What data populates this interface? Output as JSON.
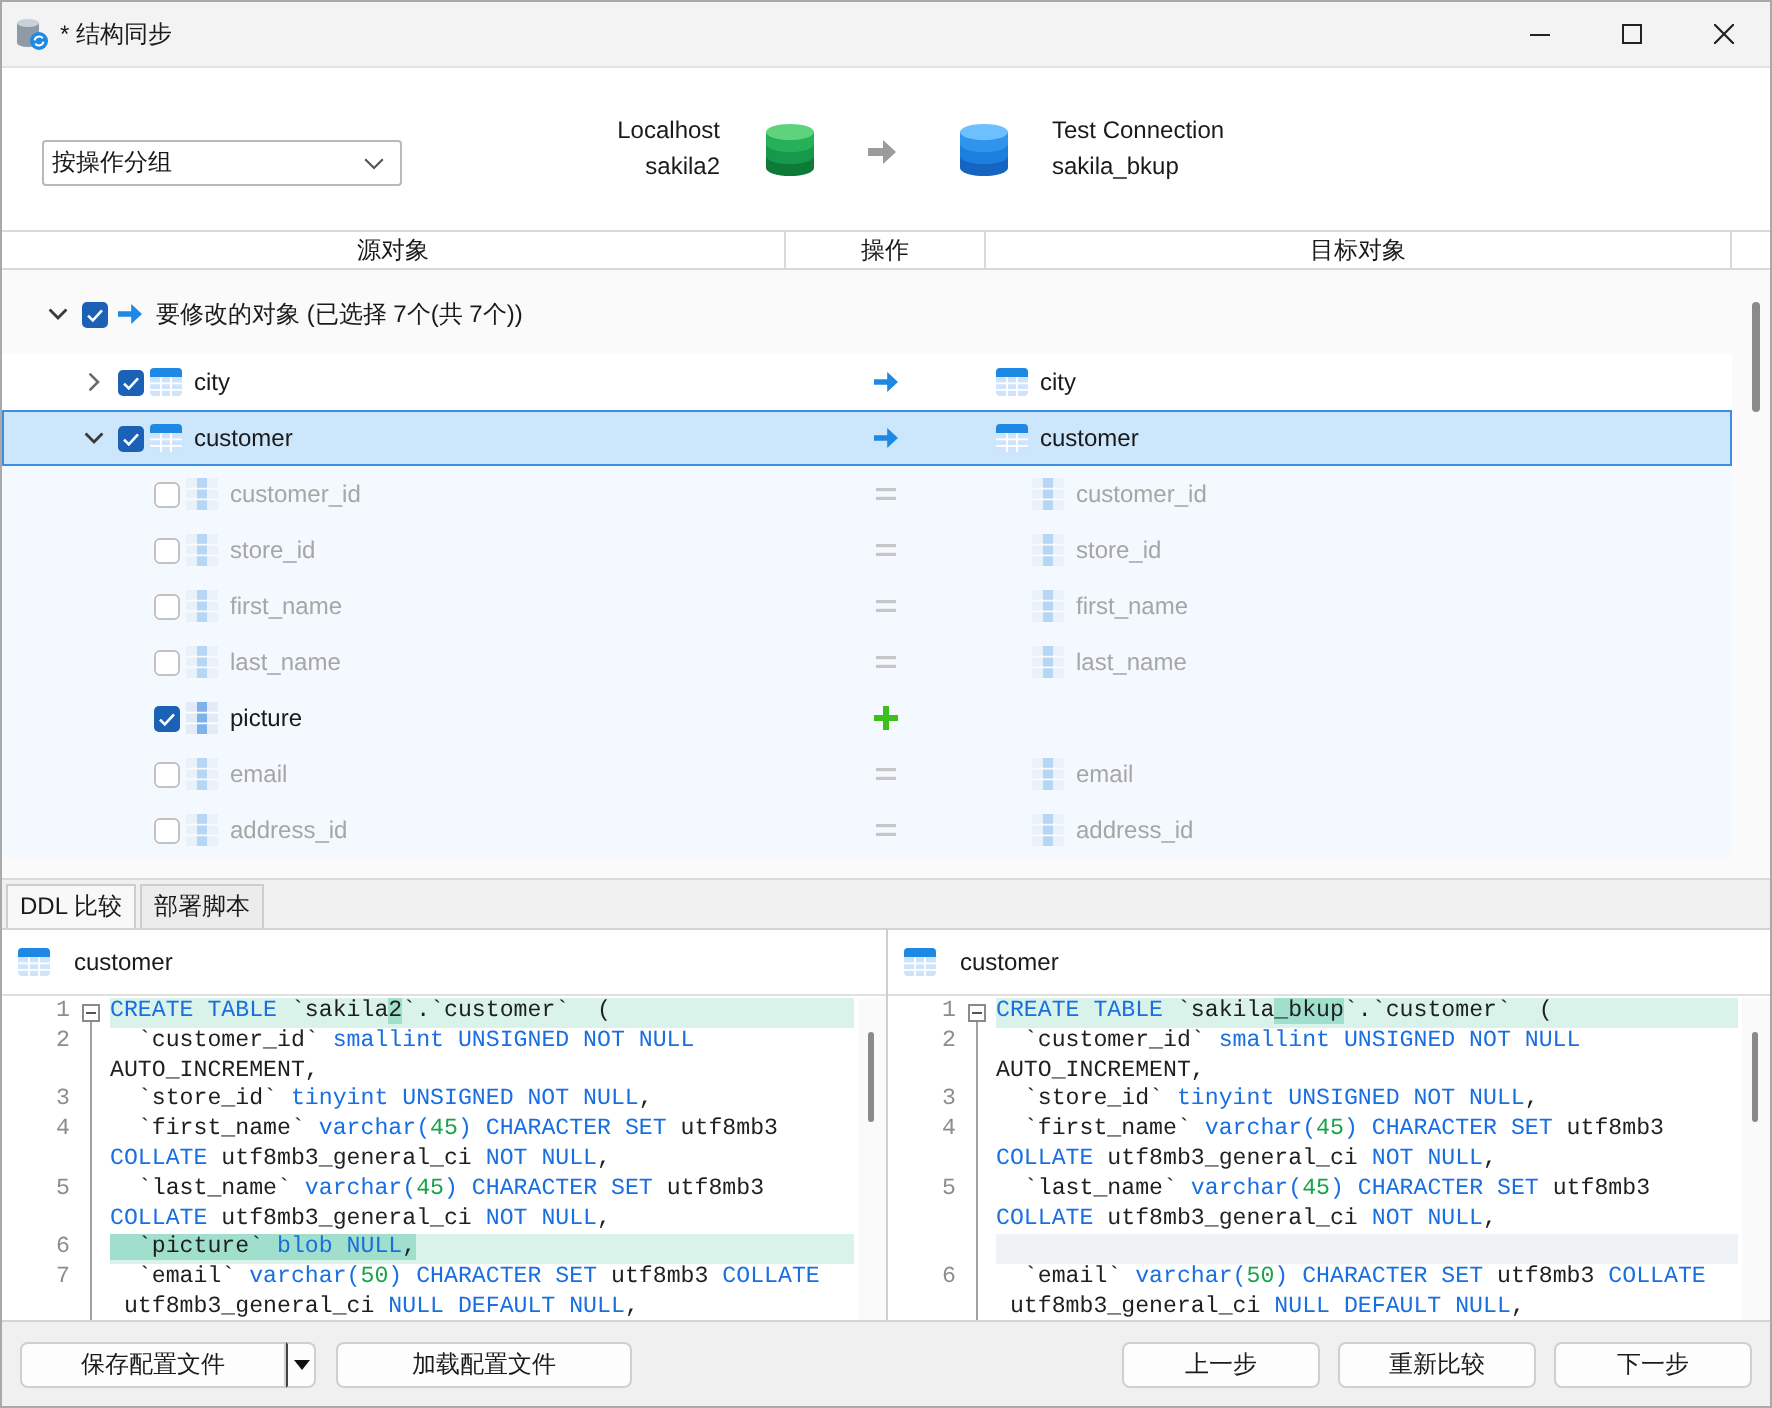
{
  "window": {
    "title": "* 结构同步"
  },
  "toolbar": {
    "group_by": {
      "value": "按操作分组"
    },
    "source": {
      "connection": "Localhost",
      "database": "sakila2"
    },
    "target": {
      "connection": "Test Connection",
      "database": "sakila_bkup"
    }
  },
  "tree": {
    "columns": [
      "源对象",
      "操作",
      "目标对象"
    ],
    "groups": [
      {
        "label": "要修改的对象 (已选择 7个(共 7个))",
        "operation": {
          "kind": "modify"
        },
        "checked": true,
        "expanded": true,
        "selected": false,
        "children": [
          {
            "kind": "table",
            "source": "city",
            "operation": {
              "kind": "modify"
            },
            "target": "city",
            "checked": true,
            "expanded": false,
            "selected": false
          },
          {
            "kind": "table",
            "source": "customer",
            "operation": {
              "kind": "modify"
            },
            "target": "customer",
            "checked": true,
            "expanded": true,
            "selected": true,
            "children": [
              {
                "kind": "column",
                "source": "customer_id",
                "operation": {
                  "kind": "same"
                },
                "target": "customer_id",
                "checked": false,
                "selected": false
              },
              {
                "kind": "column",
                "source": "store_id",
                "operation": {
                  "kind": "same"
                },
                "target": "store_id",
                "checked": false,
                "selected": false
              },
              {
                "kind": "column",
                "source": "first_name",
                "operation": {
                  "kind": "same"
                },
                "target": "first_name",
                "checked": false,
                "selected": false
              },
              {
                "kind": "column",
                "source": "last_name",
                "operation": {
                  "kind": "same"
                },
                "target": "last_name",
                "checked": false,
                "selected": false
              },
              {
                "kind": "column",
                "source": "picture",
                "operation": {
                  "kind": "add"
                },
                "checked": true,
                "selected": false
              },
              {
                "kind": "column",
                "source": "email",
                "operation": {
                  "kind": "same"
                },
                "target": "email",
                "checked": false,
                "selected": false
              },
              {
                "kind": "column",
                "source": "address_id",
                "operation": {
                  "kind": "same"
                },
                "target": "address_id",
                "checked": false,
                "selected": false
              }
            ]
          }
        ]
      }
    ]
  },
  "tabs": [
    {
      "label": "DDL 比较",
      "selected": true
    },
    {
      "label": "部署脚本",
      "selected": false
    }
  ],
  "ddl": {
    "panes": [
      {
        "title": "customer",
        "lines": [
          {
            "number": "1",
            "kind": "code",
            "changed": true,
            "folded": false,
            "tokens": [
              {
                "text": "CREATE TABLE",
                "kind": "keyword"
              },
              {
                "text": " `sakila",
                "kind": "plain"
              },
              {
                "text": "2",
                "kind": "added"
              },
              {
                "text": "`.`customer`  (",
                "kind": "plain"
              }
            ]
          },
          {
            "number": "2",
            "kind": "code",
            "changed": false,
            "tokens": [
              {
                "text": "  `customer_id` ",
                "kind": "plain"
              },
              {
                "text": "smallint UNSIGNED NOT NULL",
                "kind": "keyword"
              }
            ]
          },
          {
            "kind": "code",
            "changed": false,
            "tokens": [
              {
                "text": "AUTO_INCREMENT,",
                "kind": "plain"
              }
            ]
          },
          {
            "number": "3",
            "kind": "code",
            "changed": false,
            "tokens": [
              {
                "text": "  `store_id` ",
                "kind": "plain"
              },
              {
                "text": "tinyint UNSIGNED NOT NULL",
                "kind": "keyword"
              },
              {
                "text": ",",
                "kind": "plain"
              }
            ]
          },
          {
            "number": "4",
            "kind": "code",
            "changed": false,
            "tokens": [
              {
                "text": "  `first_name` ",
                "kind": "plain"
              },
              {
                "text": "varchar(",
                "kind": "keyword"
              },
              {
                "text": "45",
                "kind": "number"
              },
              {
                "text": ") CHARACTER SET",
                "kind": "keyword"
              },
              {
                "text": " utf8mb3",
                "kind": "plain"
              }
            ]
          },
          {
            "kind": "code",
            "changed": false,
            "tokens": [
              {
                "text": "COLLATE",
                "kind": "keyword"
              },
              {
                "text": " utf8mb3_general_ci ",
                "kind": "plain"
              },
              {
                "text": "NOT NULL",
                "kind": "keyword"
              },
              {
                "text": ",",
                "kind": "plain"
              }
            ]
          },
          {
            "number": "5",
            "kind": "code",
            "changed": false,
            "tokens": [
              {
                "text": "  `last_name` ",
                "kind": "plain"
              },
              {
                "text": "varchar(",
                "kind": "keyword"
              },
              {
                "text": "45",
                "kind": "number"
              },
              {
                "text": ") CHARACTER SET",
                "kind": "keyword"
              },
              {
                "text": " utf8mb3",
                "kind": "plain"
              }
            ]
          },
          {
            "kind": "code",
            "changed": false,
            "tokens": [
              {
                "text": "COLLATE",
                "kind": "keyword"
              },
              {
                "text": " utf8mb3_general_ci ",
                "kind": "plain"
              },
              {
                "text": "NOT NULL",
                "kind": "keyword"
              },
              {
                "text": ",",
                "kind": "plain"
              }
            ]
          },
          {
            "number": "6",
            "kind": "code",
            "changed": true,
            "tokens": [
              {
                "text": "  `picture` ",
                "kind": "added"
              },
              {
                "text": "blob NULL",
                "kind": "added_keyword"
              },
              {
                "text": ",",
                "kind": "added"
              }
            ]
          },
          {
            "number": "7",
            "kind": "code",
            "changed": false,
            "tokens": [
              {
                "text": "  `email` ",
                "kind": "plain"
              },
              {
                "text": "varchar(",
                "kind": "keyword"
              },
              {
                "text": "50",
                "kind": "number"
              },
              {
                "text": ") CHARACTER SET",
                "kind": "keyword"
              },
              {
                "text": " utf8mb3 ",
                "kind": "plain"
              },
              {
                "text": "COLLATE",
                "kind": "keyword"
              }
            ]
          },
          {
            "kind": "code",
            "changed": false,
            "tokens": [
              {
                "text": " utf8mb3_general_ci ",
                "kind": "plain"
              },
              {
                "text": "NULL DEFAULT NULL",
                "kind": "keyword"
              },
              {
                "text": ",",
                "kind": "plain"
              }
            ]
          }
        ]
      },
      {
        "title": "customer",
        "lines": [
          {
            "number": "1",
            "kind": "code",
            "changed": true,
            "folded": false,
            "tokens": [
              {
                "text": "CREATE TABLE",
                "kind": "keyword"
              },
              {
                "text": " `sakila",
                "kind": "plain"
              },
              {
                "text": "_bkup",
                "kind": "added"
              },
              {
                "text": "`.`customer`  (",
                "kind": "plain"
              }
            ]
          },
          {
            "number": "2",
            "kind": "code",
            "changed": false,
            "tokens": [
              {
                "text": "  `customer_id` ",
                "kind": "plain"
              },
              {
                "text": "smallint UNSIGNED NOT NULL",
                "kind": "keyword"
              }
            ]
          },
          {
            "kind": "code",
            "changed": false,
            "tokens": [
              {
                "text": "AUTO_INCREMENT,",
                "kind": "plain"
              }
            ]
          },
          {
            "number": "3",
            "kind": "code",
            "changed": false,
            "tokens": [
              {
                "text": "  `store_id` ",
                "kind": "plain"
              },
              {
                "text": "tinyint UNSIGNED NOT NULL",
                "kind": "keyword"
              },
              {
                "text": ",",
                "kind": "plain"
              }
            ]
          },
          {
            "number": "4",
            "kind": "code",
            "changed": false,
            "tokens": [
              {
                "text": "  `first_name` ",
                "kind": "plain"
              },
              {
                "text": "varchar(",
                "kind": "keyword"
              },
              {
                "text": "45",
                "kind": "number"
              },
              {
                "text": ") CHARACTER SET",
                "kind": "keyword"
              },
              {
                "text": " utf8mb3",
                "kind": "plain"
              }
            ]
          },
          {
            "kind": "code",
            "changed": false,
            "tokens": [
              {
                "text": "COLLATE",
                "kind": "keyword"
              },
              {
                "text": " utf8mb3_general_ci ",
                "kind": "plain"
              },
              {
                "text": "NOT NULL",
                "kind": "keyword"
              },
              {
                "text": ",",
                "kind": "plain"
              }
            ]
          },
          {
            "number": "5",
            "kind": "code",
            "changed": false,
            "tokens": [
              {
                "text": "  `last_name` ",
                "kind": "plain"
              },
              {
                "text": "varchar(",
                "kind": "keyword"
              },
              {
                "text": "45",
                "kind": "number"
              },
              {
                "text": ") CHARACTER SET",
                "kind": "keyword"
              },
              {
                "text": " utf8mb3",
                "kind": "plain"
              }
            ]
          },
          {
            "kind": "code",
            "changed": false,
            "tokens": [
              {
                "text": "COLLATE",
                "kind": "keyword"
              },
              {
                "text": " utf8mb3_general_ci ",
                "kind": "plain"
              },
              {
                "text": "NOT NULL",
                "kind": "keyword"
              },
              {
                "text": ",",
                "kind": "plain"
              }
            ]
          },
          {
            "kind": "gap"
          },
          {
            "number": "6",
            "kind": "code",
            "changed": false,
            "tokens": [
              {
                "text": "  `email` ",
                "kind": "plain"
              },
              {
                "text": "varchar(",
                "kind": "keyword"
              },
              {
                "text": "50",
                "kind": "number"
              },
              {
                "text": ") CHARACTER SET",
                "kind": "keyword"
              },
              {
                "text": " utf8mb3 ",
                "kind": "plain"
              },
              {
                "text": "COLLATE",
                "kind": "keyword"
              }
            ]
          },
          {
            "kind": "code",
            "changed": false,
            "tokens": [
              {
                "text": " utf8mb3_general_ci ",
                "kind": "plain"
              },
              {
                "text": "NULL DEFAULT NULL",
                "kind": "keyword"
              },
              {
                "text": ",",
                "kind": "plain"
              }
            ]
          }
        ]
      }
    ]
  },
  "buttons": {
    "left": [
      {
        "label": "保存配置文件",
        "split": true
      },
      {
        "label": "加载配置文件",
        "split": false
      }
    ],
    "right": [
      {
        "label": "上一步",
        "split": false
      },
      {
        "label": "重新比较",
        "split": false
      },
      {
        "label": "下一步",
        "split": false
      }
    ]
  }
}
